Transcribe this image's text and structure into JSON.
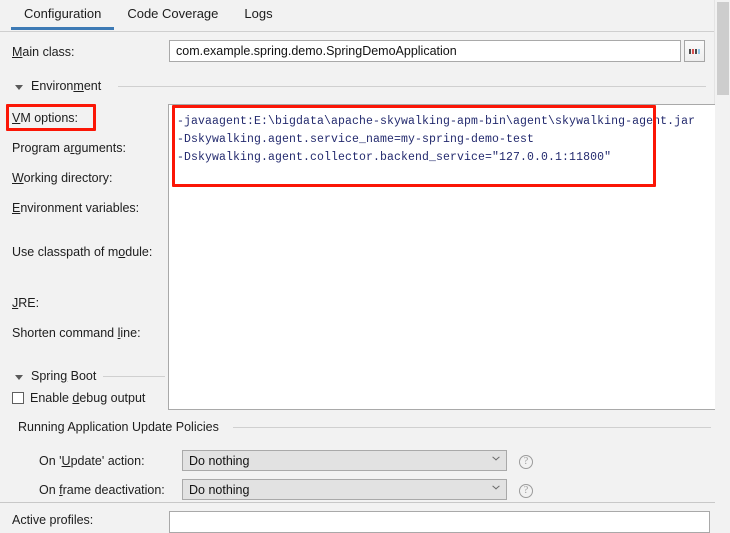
{
  "theme": {
    "accent_blue": "#3d7ab5",
    "annotation_red": "#fb1606",
    "code_text": "#232a6e",
    "panel_bg": "#f2f2f2",
    "field_bg": "#ffffff",
    "combo_bg": "#e2e2e2"
  },
  "tabs": [
    {
      "label": "Configuration",
      "active": true
    },
    {
      "label": "Code Coverage",
      "active": false
    },
    {
      "label": "Logs",
      "active": false
    }
  ],
  "main_class": {
    "label": "Main class:",
    "mnemonic": "M",
    "value": "com.example.spring.demo.SpringDemoApplication",
    "placeholder": "",
    "browse_button_label": "..."
  },
  "environment": {
    "group_title": "Environment",
    "group_mnemonic": "m",
    "expanded": true,
    "fields": [
      {
        "name": "vm-options",
        "label": "VM options:",
        "mnemonic": "V",
        "value": "-javaagent:E:\\bigdata\\apache-skywalking-apm-bin\\agent\\skywalking-agent.jar\n-Dskywalking.agent.service_name=my-spring-demo-test\n-Dskywalking.agent.collector.backend_service=\"127.0.0.1:11800\"",
        "highlighted": true
      },
      {
        "name": "program-arguments",
        "label": "Program arguments:",
        "mnemonic": "r",
        "value": ""
      },
      {
        "name": "working-directory",
        "label": "Working directory:",
        "mnemonic": "W",
        "value": ""
      },
      {
        "name": "environment-variables",
        "label": "Environment variables:",
        "mnemonic": "E",
        "value": ""
      },
      {
        "name": "use-classpath-of-module",
        "label": "Use classpath of module:",
        "mnemonic": "o",
        "value": ""
      },
      {
        "name": "jre",
        "label": "JRE:",
        "mnemonic": "J",
        "value": ""
      },
      {
        "name": "shorten-command-line",
        "label": "Shorten command line:",
        "mnemonic": "l",
        "value": ""
      }
    ]
  },
  "spring_boot": {
    "group_title": "Spring Boot",
    "group_mnemonic": "g",
    "expanded": true,
    "enable_debug_output": {
      "label": "Enable debug output",
      "mnemonic": "d",
      "checked": false
    }
  },
  "running_application_update_policies": {
    "group_title": "Running Application Update Policies",
    "rows": [
      {
        "label": "On 'Update' action:",
        "mnemonic": "U",
        "value": "Do nothing",
        "help": "?"
      },
      {
        "label": "On frame deactivation:",
        "mnemonic": "f",
        "value": "Do nothing",
        "help": "?"
      }
    ]
  },
  "bottom_row": {
    "label": "Active profiles:",
    "value": ""
  },
  "icons": {
    "expand_arrow": "triangle-down-icon",
    "dropdown_chevron": "chevron-down-icon",
    "help": "help-circle-icon",
    "browse": "ellipsis-icon",
    "checkbox": "checkbox-icon",
    "scrollbar": "scrollbar-thumb"
  }
}
